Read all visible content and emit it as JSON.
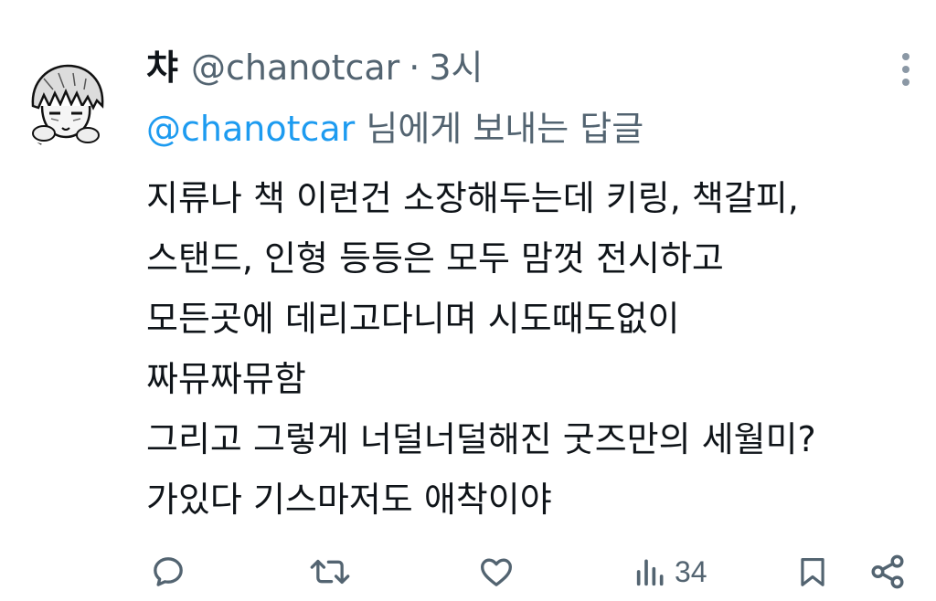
{
  "tweet": {
    "display_name": "챠",
    "handle": "@chanotcar",
    "separator": "·",
    "time": "3시",
    "reply_to": {
      "handle": "@chanotcar",
      "suffix": " 님에게 보내는 답글"
    },
    "lines": [
      "지류나 책 이런건 소장해두는데 키링, 책갈피,",
      "스탠드, 인형 등등은 모두 맘껏 전시하고",
      "모든곳에 데리고다니며 시도때도없이",
      "짜뮤짜뮤함",
      "그리고 그렇게 너덜너덜해진 굿즈만의 세월미?",
      "가있다 기스마저도 애착이야"
    ],
    "views": "34"
  },
  "icons": {
    "more": "more-vertical-icon",
    "reply": "reply-icon",
    "retweet": "retweet-icon",
    "like": "heart-icon",
    "views": "views-icon",
    "bookmark": "bookmark-icon",
    "share": "share-icon"
  },
  "colors": {
    "text": "#0f1419",
    "secondary": "#536471",
    "link": "#1d9bf0",
    "icon": "#536471"
  }
}
